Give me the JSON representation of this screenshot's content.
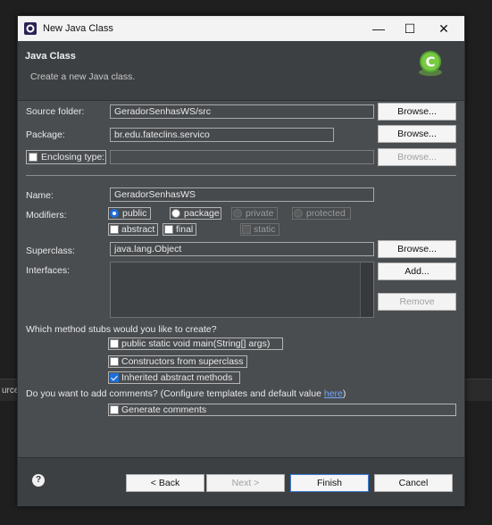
{
  "ide": {
    "partial_text": "urce"
  },
  "window": {
    "title": "New Java Class",
    "minimize_icon": "minimize-icon",
    "maximize_icon": "maximize-icon",
    "close_icon": "close-icon",
    "minimize": "—",
    "maximize": "☐",
    "close": "✕"
  },
  "header": {
    "title": "Java Class",
    "description": "Create a new Java class."
  },
  "source_folder": {
    "label": "Source folder:",
    "value": "GeradorSenhasWS/src",
    "browse": "Browse..."
  },
  "package": {
    "label": "Package:",
    "value": "br.edu.fateclins.servico",
    "browse": "Browse..."
  },
  "enclosing_type": {
    "label": "Enclosing type:",
    "value": "",
    "browse": "Browse...",
    "checked": false
  },
  "name": {
    "label": "Name:",
    "value": "GeradorSenhasWS"
  },
  "modifiers": {
    "label": "Modifiers:",
    "public": "public",
    "package": "package",
    "private": "private",
    "protected": "protected",
    "abstract": "abstract",
    "final": "final",
    "static": "static",
    "selected": "public"
  },
  "superclass": {
    "label": "Superclass:",
    "value": "java.lang.Object",
    "browse": "Browse..."
  },
  "interfaces": {
    "label": "Interfaces:",
    "add": "Add...",
    "remove": "Remove"
  },
  "stubs": {
    "question": "Which method stubs would you like to create?",
    "main": "public static void main(String[] args)",
    "constructors": "Constructors from superclass",
    "inherited": "Inherited abstract methods",
    "main_checked": false,
    "constructors_checked": false,
    "inherited_checked": true
  },
  "comments": {
    "question_prefix": "Do you want to add comments? (Configure templates and default value ",
    "question_link": "here",
    "question_suffix": ")",
    "generate": "Generate comments",
    "generate_checked": false
  },
  "footer": {
    "help": "?",
    "back": "< Back",
    "next": "Next >",
    "finish": "Finish",
    "cancel": "Cancel"
  },
  "colors": {
    "accent": "#1e6fd9",
    "dialog_bg": "#4a4d50",
    "header_bg": "#3d4043"
  }
}
